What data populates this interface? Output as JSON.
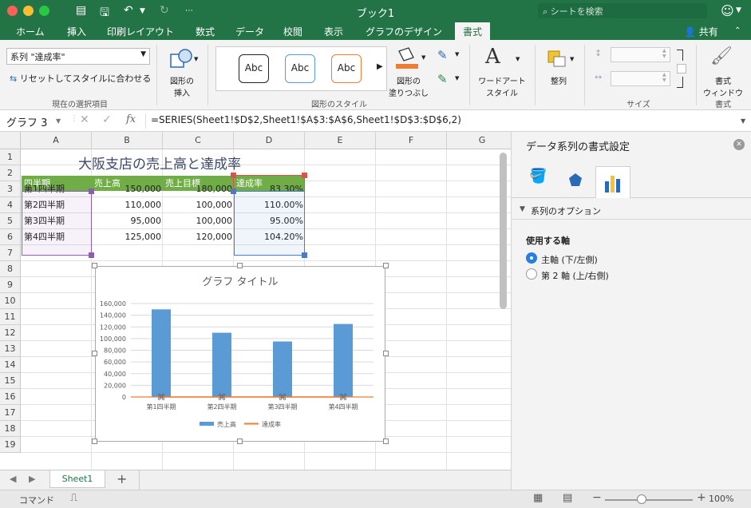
{
  "window": {
    "title": "ブック1",
    "search_placeholder": "シートを検索"
  },
  "tabs": [
    "ホーム",
    "挿入",
    "印刷レイアウト",
    "数式",
    "データ",
    "校閲",
    "表示",
    "グラフのデザイン",
    "書式"
  ],
  "share_label": "共有",
  "ribbon": {
    "selection_combo": "系列 \"達成率\"",
    "reset_label": "リセットしてスタイルに合わせる",
    "group_current": "現在の選択項目",
    "insert_shape_label": "図形の\n挿入",
    "style_sample": "Abc",
    "fill_label": "図形の\n塗りつぶし",
    "group_styles": "図形のスタイル",
    "wordart_label": "ワードアート\nスタイル",
    "arrange_label": "整列",
    "group_size": "サイズ",
    "format_window_label": "書式\nウィンドウ",
    "group_format": "書式"
  },
  "formula": {
    "name_box": "グラフ 3",
    "fx": "fx",
    "content": "=SERIES(Sheet1!$D$2,Sheet1!$A$3:$A$6,Sheet1!$D$3:$D$6,2)"
  },
  "sheet": {
    "columns": [
      "A",
      "B",
      "C",
      "D",
      "E",
      "F",
      "G"
    ],
    "rows": [
      "1",
      "2",
      "3",
      "4",
      "5",
      "6",
      "7",
      "8",
      "9",
      "10",
      "11",
      "12",
      "13",
      "14",
      "15",
      "16",
      "17",
      "18",
      "19"
    ],
    "title": "大阪支店の売上高と達成率",
    "headers": [
      "四半期",
      "売上高",
      "売上目標",
      "達成率"
    ],
    "data": [
      [
        "第1四半期",
        "150,000",
        "180,000",
        "83.30%"
      ],
      [
        "第2四半期",
        "110,000",
        "100,000",
        "110.00%"
      ],
      [
        "第3四半期",
        "95,000",
        "100,000",
        "95.00%"
      ],
      [
        "第4四半期",
        "125,000",
        "120,000",
        "104.20%"
      ]
    ]
  },
  "chart_data": {
    "type": "bar",
    "title": "グラフ タイトル",
    "categories": [
      "第1四半期",
      "第2四半期",
      "第3四半期",
      "第4四半期"
    ],
    "series": [
      {
        "name": "売上高",
        "values": [
          150000,
          110000,
          95000,
          125000
        ]
      },
      {
        "name": "達成率",
        "values": [
          0.833,
          1.1,
          0.95,
          1.042
        ]
      }
    ],
    "yticks": [
      "0",
      "20,000",
      "40,000",
      "60,000",
      "80,000",
      "100,000",
      "120,000",
      "140,000",
      "160,000"
    ],
    "ylim": [
      0,
      160000
    ],
    "legend": "bottom",
    "colors": {
      "bar": "#5b9bd5",
      "line": "#ed7d31"
    }
  },
  "sheet_tab": "Sheet1",
  "status": {
    "mode": "コマンド",
    "zoom": "100%"
  },
  "pane": {
    "title": "データ系列の書式設定",
    "section": "系列のオプション",
    "axis_label": "使用する軸",
    "primary": "主軸 (下/左側)",
    "secondary": "第 2 軸 (上/右側)"
  }
}
